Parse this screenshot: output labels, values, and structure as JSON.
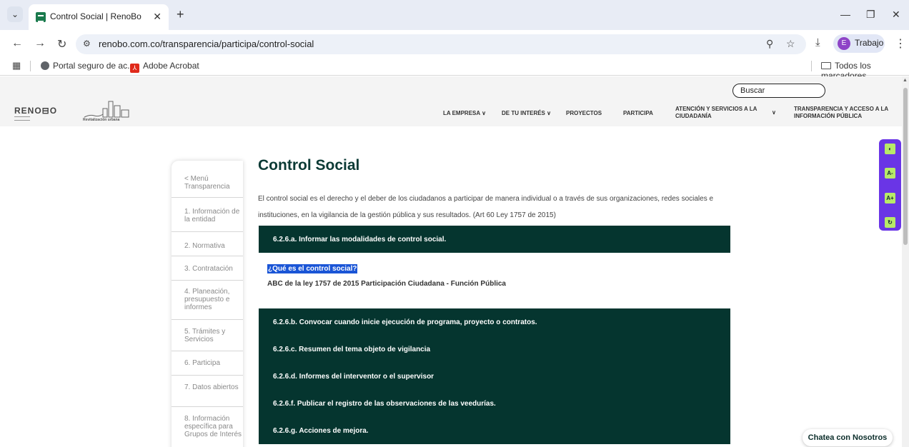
{
  "browser": {
    "tab_title": "Control Social | RenoBo",
    "tab_close": "✕",
    "new_tab": "+",
    "url": "renobo.com.co/transparencia/participa/control-social",
    "profile_initial": "E",
    "profile_label": "Trabajo",
    "bookmarks": [
      {
        "label": "Portal seguro de ac..."
      },
      {
        "label": "Adobe Acrobat"
      }
    ],
    "all_bookmarks": "Todos los marcadores"
  },
  "site": {
    "search_label": "Buscar",
    "logo": "RENO⊟O",
    "logo_caption": "Revitalización urbana",
    "nav": [
      {
        "label": "LA EMPRESA ∨"
      },
      {
        "label": "DE TU INTERÉS ∨"
      },
      {
        "label": "PROYECTOS"
      },
      {
        "label": "PARTICIPA"
      },
      {
        "label": "ATENCIÓN Y SERVICIOS A LA CIUDADANÍA"
      },
      {
        "label": "∨"
      },
      {
        "label": "TRANSPARENCIA Y ACCESO A LA INFORMACIÓN PÚBLICA"
      }
    ]
  },
  "sidebar": {
    "items": [
      {
        "label": "< Menú Transparencia"
      },
      {
        "label": "1. Información de la entidad"
      },
      {
        "label": "2. Normativa"
      },
      {
        "label": "3. Contratación"
      },
      {
        "label": "4. Planeación, presupuesto e informes"
      },
      {
        "label": "5. Trámites y Servicios"
      },
      {
        "label": "6. Participa"
      },
      {
        "label": "7. Datos abiertos"
      },
      {
        "label": "8. Información específica para Grupos de Interés"
      }
    ]
  },
  "main": {
    "title": "Control Social",
    "intro": "El control social es el derecho y el deber de los ciudadanos a participar de manera individual o a través de sus organizaciones, redes sociales e instituciones, en la vigilancia de la gestión pública y sus resultados. (Art 60 Ley 1757 de 2015)",
    "sections": [
      {
        "label": "6.2.6.a. Informar las modalidades de control social."
      },
      {
        "label": "6.2.6.b. Convocar cuando inicie ejecución de programa, proyecto o contratos."
      },
      {
        "label": "6.2.6.c. Resumen del tema objeto de vigilancia"
      },
      {
        "label": "6.2.6.d. Informes del interventor o el supervisor"
      },
      {
        "label": "6.2.6.f. Publicar el registro de las observaciones de las veedurías."
      },
      {
        "label": "6.2.6.g. Acciones de mejora."
      }
    ],
    "open_section": {
      "question": "¿Qué es el control social?",
      "link": "ABC de la ley 1757 de 2015 Participación Ciudadana - Función Pública"
    }
  },
  "widget": {
    "buttons": [
      {
        "label": "◐"
      },
      {
        "label": "A-"
      },
      {
        "label": "A+"
      },
      {
        "label": "↻"
      }
    ]
  },
  "chat": {
    "label": "Chatea con Nosotros"
  }
}
